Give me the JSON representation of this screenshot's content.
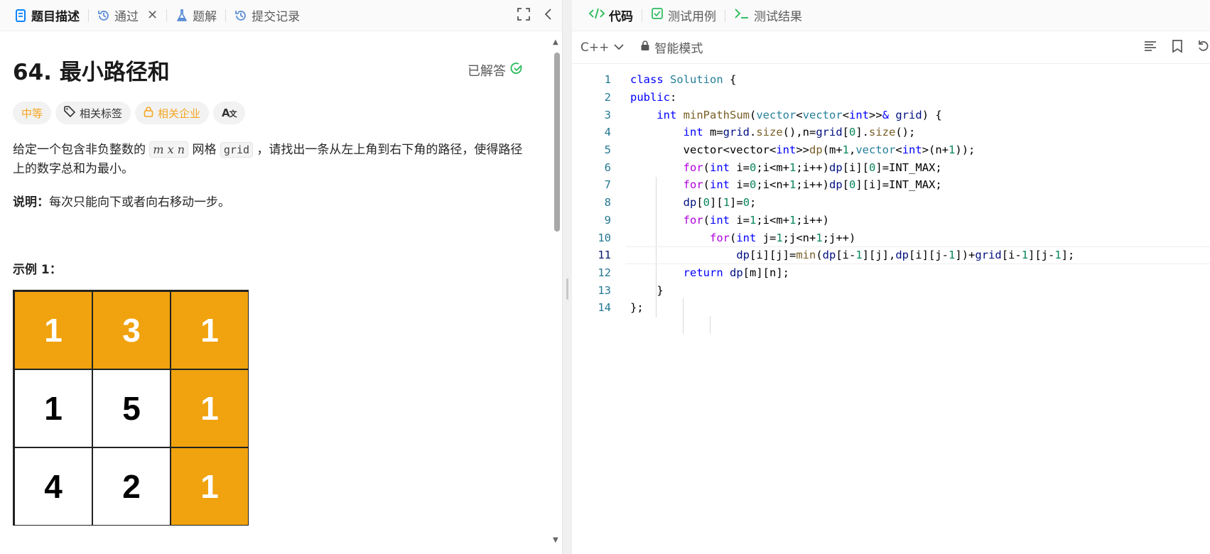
{
  "left_tabs": [
    {
      "label": "题目描述",
      "icon": "document-icon",
      "active": true
    },
    {
      "label": "通过",
      "icon": "history-icon",
      "closable": true
    },
    {
      "label": "题解",
      "icon": "flask-icon"
    },
    {
      "label": "提交记录",
      "icon": "history-icon"
    }
  ],
  "problem": {
    "title": "64. 最小路径和",
    "status": "已解答",
    "tags": {
      "difficulty": "中等",
      "topics": "相关标签",
      "companies": "相关企业",
      "translate": "A文"
    },
    "desc_part1": "给定一个包含非负整数的 ",
    "desc_math": "m x n",
    "desc_part2": " 网格 ",
    "desc_code": "grid",
    "desc_part3": " ，请找出一条从左上角到右下角的路径，使得路径上的数字总和为最小。",
    "note_label": "说明：",
    "note_text": "每次只能向下或者向右移动一步。",
    "example_title": "示例 1：",
    "grid": [
      [
        "1",
        "3",
        "1"
      ],
      [
        "1",
        "5",
        "1"
      ],
      [
        "4",
        "2",
        "1"
      ]
    ]
  },
  "right_tabs": [
    {
      "label": "代码",
      "icon": "code-icon",
      "active": true
    },
    {
      "label": "测试用例",
      "icon": "checkbox-icon"
    },
    {
      "label": "测试结果",
      "icon": "terminal-icon"
    }
  ],
  "editor": {
    "language": "C++",
    "mode": "智能模式",
    "line_numbers": [
      "1",
      "2",
      "3",
      "4",
      "5",
      "6",
      "7",
      "8",
      "9",
      "10",
      "11",
      "12",
      "13",
      "14"
    ],
    "current_line": 11
  },
  "colors": {
    "highlight_cell": "#f0a30e",
    "accent_green": "#2cbb5d",
    "difficulty_medium": "#f5a623"
  }
}
